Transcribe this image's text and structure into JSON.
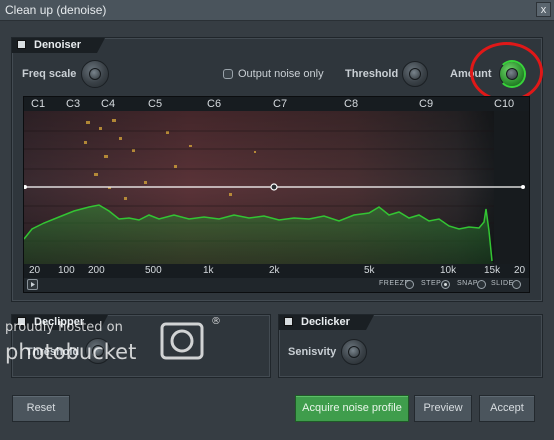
{
  "window": {
    "title": "Clean up (denoise)",
    "close_glyph": "x"
  },
  "denoiser": {
    "section_label": "Denoiser",
    "freq_scale_label": "Freq scale",
    "output_noise_only_label": "Output noise only",
    "threshold_label": "Threshold",
    "amount_label": "Amount",
    "amount_knob_color": "#38d43a"
  },
  "spectrum": {
    "note_labels": [
      "C1",
      "C3",
      "C4",
      "C5",
      "C6",
      "C7",
      "C8",
      "C9",
      "C10"
    ],
    "freq_labels": [
      "20",
      "100",
      "200",
      "500",
      "1k",
      "2k",
      "5k",
      "10k",
      "15k",
      "20"
    ],
    "options": {
      "freeze": "FREEZE",
      "step": "STEP",
      "snap": "SNAP",
      "slide": "SLIDE",
      "step_selected": true
    },
    "curve_color": "#33c433",
    "threshold_line_color": "#ffffff"
  },
  "declipper": {
    "section_label": "Declipper",
    "threshold_label": "Threshold"
  },
  "declicker": {
    "section_label": "Declicker",
    "sensitivity_label": "Senisvity"
  },
  "buttons": {
    "reset": "Reset",
    "acquire": "Acquire noise profile",
    "preview": "Preview",
    "accept": "Accept"
  },
  "watermark": {
    "line1": "proudly hosted on",
    "line2": "photobucket",
    "mark": "®"
  },
  "annotation": {
    "color": "#e01818"
  }
}
